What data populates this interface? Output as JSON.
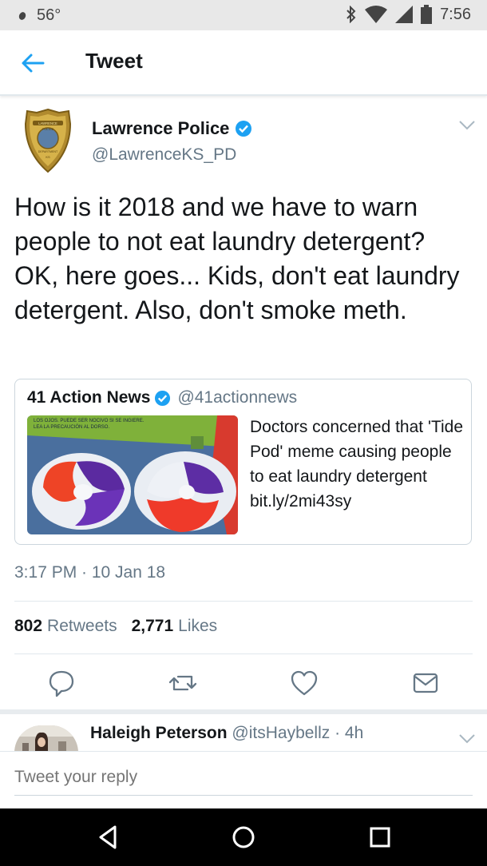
{
  "status_bar": {
    "temperature": "56°",
    "time": "7:56",
    "icons": [
      "bluetooth-icon",
      "wifi-icon",
      "signal-icon",
      "battery-icon"
    ]
  },
  "app_bar": {
    "title": "Tweet",
    "back_icon": "back-arrow-icon"
  },
  "tweet": {
    "author_name": "Lawrence Police",
    "author_handle": "@LawrenceKS_PD",
    "verified": true,
    "avatar_badge_text": [
      "LAWRENCE",
      "POLICE",
      "DEPARTMENT",
      "KS"
    ],
    "text": "How is it 2018 and we have to warn people to not eat laundry detergent? OK, here goes... Kids, don't eat laundry detergent. Also, don't smoke meth.",
    "timestamp": "3:17 PM · 10 Jan 18",
    "retweets_count": "802",
    "retweets_label": "Retweets",
    "likes_count": "2,771",
    "likes_label": "Likes"
  },
  "quoted_tweet": {
    "name": "41 Action News",
    "handle": "@41actionnews",
    "verified": true,
    "text": "Doctors concerned that 'Tide Pod' meme causing people to eat laundry detergent bit.ly/2mi43sy",
    "image_text": [
      "LOS OJOS. PUEDE SER NOCIVO SI SE INGIERE.",
      "LEA LA PRECAUCIÓN AL DORSO."
    ]
  },
  "actions": [
    "reply-icon",
    "retweet-icon",
    "like-icon",
    "direct-message-icon"
  ],
  "reply": {
    "name": "Haleigh Peterson",
    "handle": "@itsHaybellz",
    "time": "· 4h"
  },
  "composer": {
    "placeholder": "Tweet your reply"
  },
  "colors": {
    "verified_blue": "#1da1f2",
    "link_blue": "#1da1f2",
    "text_dark": "#14171a",
    "text_gray": "#657786",
    "nav_bar": "#000000"
  }
}
